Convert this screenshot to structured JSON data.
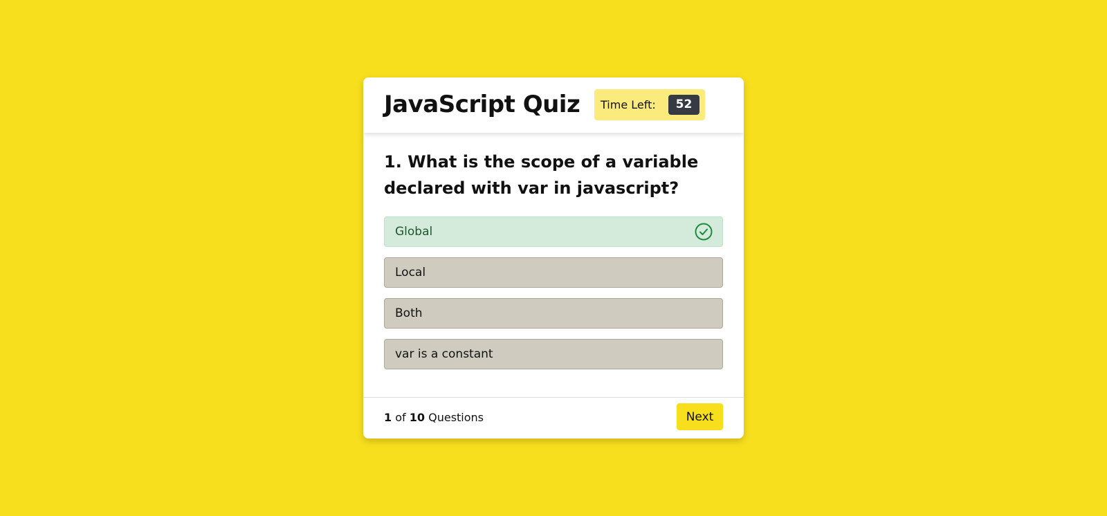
{
  "quiz": {
    "title": "JavaScript Quiz",
    "timer_label": "Time Left:",
    "timer_value": "52",
    "question": "1. What is the scope of a variable declared with var in javascript?",
    "options": [
      {
        "label": "Global",
        "state": "correct"
      },
      {
        "label": "Local",
        "state": "disabled"
      },
      {
        "label": "Both",
        "state": "disabled"
      },
      {
        "label": "var is a constant",
        "state": "disabled"
      }
    ],
    "footer": {
      "current": "1",
      "of_text": "of",
      "total": "10",
      "suffix": "Questions"
    },
    "next_label": "Next",
    "correct_icon": "check-circle-icon"
  },
  "colors": {
    "background": "#f7df1e",
    "correct_bg": "#d4ebdc",
    "correct_accent": "#1e8a3e",
    "option_bg": "#cfccbf",
    "timer_bg": "#fbea7c",
    "timer_value_bg": "#363a43"
  }
}
